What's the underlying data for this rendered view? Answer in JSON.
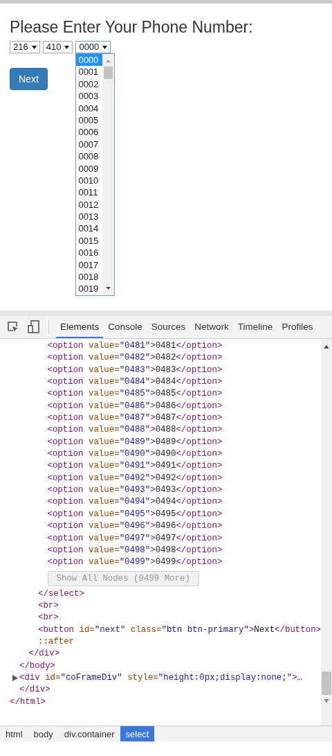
{
  "page": {
    "title": "Please Enter Your Phone Number:",
    "selects": [
      {
        "value": "216",
        "open": false
      },
      {
        "value": "410",
        "open": false
      },
      {
        "value": "0000",
        "open": true
      }
    ],
    "dropdown_options": [
      {
        "label": "0000",
        "selected": true
      },
      {
        "label": "0001",
        "selected": false
      },
      {
        "label": "0002",
        "selected": false
      },
      {
        "label": "0003",
        "selected": false
      },
      {
        "label": "0004",
        "selected": false
      },
      {
        "label": "0005",
        "selected": false
      },
      {
        "label": "0006",
        "selected": false
      },
      {
        "label": "0007",
        "selected": false
      },
      {
        "label": "0008",
        "selected": false
      },
      {
        "label": "0009",
        "selected": false
      },
      {
        "label": "0010",
        "selected": false
      },
      {
        "label": "0011",
        "selected": false
      },
      {
        "label": "0012",
        "selected": false
      },
      {
        "label": "0013",
        "selected": false
      },
      {
        "label": "0014",
        "selected": false
      },
      {
        "label": "0015",
        "selected": false
      },
      {
        "label": "0016",
        "selected": false
      },
      {
        "label": "0017",
        "selected": false
      },
      {
        "label": "0018",
        "selected": false
      },
      {
        "label": "0019",
        "selected": false
      }
    ],
    "next_button": "Next"
  },
  "devtools": {
    "tabs": [
      {
        "label": "Elements",
        "selected": true
      },
      {
        "label": "Console",
        "selected": false
      },
      {
        "label": "Sources",
        "selected": false
      },
      {
        "label": "Network",
        "selected": false
      },
      {
        "label": "Timeline",
        "selected": false
      },
      {
        "label": "Profiles",
        "selected": false
      }
    ],
    "dom_tree": [
      {
        "closing": [
          {
            "kind": "tag",
            "text": "</html>"
          }
        ],
        "children": [
          {
            "closing": [
              {
                "kind": "tag",
                "text": "</body>"
              }
            ],
            "children": [
              {
                "closing": [
                  {
                    "kind": "tag",
                    "text": "</div>"
                  }
                ],
                "children": [
                  {
                    "closing": [
                      {
                        "kind": "tag",
                        "text": "</select>"
                      }
                    ],
                    "children": [
                      {
                        "tokens": [
                          {
                            "kind": "tag",
                            "text": "<option"
                          },
                          {
                            "kind": "attr",
                            "text": " value="
                          },
                          {
                            "kind": "value",
                            "text": "\"0481\""
                          },
                          {
                            "kind": "tag",
                            "text": ">"
                          },
                          {
                            "kind": "text",
                            "text": "0481"
                          },
                          {
                            "kind": "tag",
                            "text": "</option>"
                          }
                        ]
                      },
                      {
                        "tokens": [
                          {
                            "kind": "tag",
                            "text": "<option"
                          },
                          {
                            "kind": "attr",
                            "text": " value="
                          },
                          {
                            "kind": "value",
                            "text": "\"0482\""
                          },
                          {
                            "kind": "tag",
                            "text": ">"
                          },
                          {
                            "kind": "text",
                            "text": "0482"
                          },
                          {
                            "kind": "tag",
                            "text": "</option>"
                          }
                        ]
                      },
                      {
                        "tokens": [
                          {
                            "kind": "tag",
                            "text": "<option"
                          },
                          {
                            "kind": "attr",
                            "text": " value="
                          },
                          {
                            "kind": "value",
                            "text": "\"0483\""
                          },
                          {
                            "kind": "tag",
                            "text": ">"
                          },
                          {
                            "kind": "text",
                            "text": "0483"
                          },
                          {
                            "kind": "tag",
                            "text": "</option>"
                          }
                        ]
                      },
                      {
                        "tokens": [
                          {
                            "kind": "tag",
                            "text": "<option"
                          },
                          {
                            "kind": "attr",
                            "text": " value="
                          },
                          {
                            "kind": "value",
                            "text": "\"0484\""
                          },
                          {
                            "kind": "tag",
                            "text": ">"
                          },
                          {
                            "kind": "text",
                            "text": "0484"
                          },
                          {
                            "kind": "tag",
                            "text": "</option>"
                          }
                        ]
                      },
                      {
                        "tokens": [
                          {
                            "kind": "tag",
                            "text": "<option"
                          },
                          {
                            "kind": "attr",
                            "text": " value="
                          },
                          {
                            "kind": "value",
                            "text": "\"0485\""
                          },
                          {
                            "kind": "tag",
                            "text": ">"
                          },
                          {
                            "kind": "text",
                            "text": "0485"
                          },
                          {
                            "kind": "tag",
                            "text": "</option>"
                          }
                        ]
                      },
                      {
                        "tokens": [
                          {
                            "kind": "tag",
                            "text": "<option"
                          },
                          {
                            "kind": "attr",
                            "text": " value="
                          },
                          {
                            "kind": "value",
                            "text": "\"0486\""
                          },
                          {
                            "kind": "tag",
                            "text": ">"
                          },
                          {
                            "kind": "text",
                            "text": "0486"
                          },
                          {
                            "kind": "tag",
                            "text": "</option>"
                          }
                        ]
                      },
                      {
                        "tokens": [
                          {
                            "kind": "tag",
                            "text": "<option"
                          },
                          {
                            "kind": "attr",
                            "text": " value="
                          },
                          {
                            "kind": "value",
                            "text": "\"0487\""
                          },
                          {
                            "kind": "tag",
                            "text": ">"
                          },
                          {
                            "kind": "text",
                            "text": "0487"
                          },
                          {
                            "kind": "tag",
                            "text": "</option>"
                          }
                        ]
                      },
                      {
                        "tokens": [
                          {
                            "kind": "tag",
                            "text": "<option"
                          },
                          {
                            "kind": "attr",
                            "text": " value="
                          },
                          {
                            "kind": "value",
                            "text": "\"0488\""
                          },
                          {
                            "kind": "tag",
                            "text": ">"
                          },
                          {
                            "kind": "text",
                            "text": "0488"
                          },
                          {
                            "kind": "tag",
                            "text": "</option>"
                          }
                        ]
                      },
                      {
                        "tokens": [
                          {
                            "kind": "tag",
                            "text": "<option"
                          },
                          {
                            "kind": "attr",
                            "text": " value="
                          },
                          {
                            "kind": "value",
                            "text": "\"0489\""
                          },
                          {
                            "kind": "tag",
                            "text": ">"
                          },
                          {
                            "kind": "text",
                            "text": "0489"
                          },
                          {
                            "kind": "tag",
                            "text": "</option>"
                          }
                        ]
                      },
                      {
                        "tokens": [
                          {
                            "kind": "tag",
                            "text": "<option"
                          },
                          {
                            "kind": "attr",
                            "text": " value="
                          },
                          {
                            "kind": "value",
                            "text": "\"0490\""
                          },
                          {
                            "kind": "tag",
                            "text": ">"
                          },
                          {
                            "kind": "text",
                            "text": "0490"
                          },
                          {
                            "kind": "tag",
                            "text": "</option>"
                          }
                        ]
                      },
                      {
                        "tokens": [
                          {
                            "kind": "tag",
                            "text": "<option"
                          },
                          {
                            "kind": "attr",
                            "text": " value="
                          },
                          {
                            "kind": "value",
                            "text": "\"0491\""
                          },
                          {
                            "kind": "tag",
                            "text": ">"
                          },
                          {
                            "kind": "text",
                            "text": "0491"
                          },
                          {
                            "kind": "tag",
                            "text": "</option>"
                          }
                        ]
                      },
                      {
                        "tokens": [
                          {
                            "kind": "tag",
                            "text": "<option"
                          },
                          {
                            "kind": "attr",
                            "text": " value="
                          },
                          {
                            "kind": "value",
                            "text": "\"0492\""
                          },
                          {
                            "kind": "tag",
                            "text": ">"
                          },
                          {
                            "kind": "text",
                            "text": "0492"
                          },
                          {
                            "kind": "tag",
                            "text": "</option>"
                          }
                        ]
                      },
                      {
                        "tokens": [
                          {
                            "kind": "tag",
                            "text": "<option"
                          },
                          {
                            "kind": "attr",
                            "text": " value="
                          },
                          {
                            "kind": "value",
                            "text": "\"0493\""
                          },
                          {
                            "kind": "tag",
                            "text": ">"
                          },
                          {
                            "kind": "text",
                            "text": "0493"
                          },
                          {
                            "kind": "tag",
                            "text": "</option>"
                          }
                        ]
                      },
                      {
                        "tokens": [
                          {
                            "kind": "tag",
                            "text": "<option"
                          },
                          {
                            "kind": "attr",
                            "text": " value="
                          },
                          {
                            "kind": "value",
                            "text": "\"0494\""
                          },
                          {
                            "kind": "tag",
                            "text": ">"
                          },
                          {
                            "kind": "text",
                            "text": "0494"
                          },
                          {
                            "kind": "tag",
                            "text": "</option>"
                          }
                        ]
                      },
                      {
                        "tokens": [
                          {
                            "kind": "tag",
                            "text": "<option"
                          },
                          {
                            "kind": "attr",
                            "text": " value="
                          },
                          {
                            "kind": "value",
                            "text": "\"0495\""
                          },
                          {
                            "kind": "tag",
                            "text": ">"
                          },
                          {
                            "kind": "text",
                            "text": "0495"
                          },
                          {
                            "kind": "tag",
                            "text": "</option>"
                          }
                        ]
                      },
                      {
                        "tokens": [
                          {
                            "kind": "tag",
                            "text": "<option"
                          },
                          {
                            "kind": "attr",
                            "text": " value="
                          },
                          {
                            "kind": "value",
                            "text": "\"0496\""
                          },
                          {
                            "kind": "tag",
                            "text": ">"
                          },
                          {
                            "kind": "text",
                            "text": "0496"
                          },
                          {
                            "kind": "tag",
                            "text": "</option>"
                          }
                        ]
                      },
                      {
                        "tokens": [
                          {
                            "kind": "tag",
                            "text": "<option"
                          },
                          {
                            "kind": "attr",
                            "text": " value="
                          },
                          {
                            "kind": "value",
                            "text": "\"0497\""
                          },
                          {
                            "kind": "tag",
                            "text": ">"
                          },
                          {
                            "kind": "text",
                            "text": "0497"
                          },
                          {
                            "kind": "tag",
                            "text": "</option>"
                          }
                        ]
                      },
                      {
                        "tokens": [
                          {
                            "kind": "tag",
                            "text": "<option"
                          },
                          {
                            "kind": "attr",
                            "text": " value="
                          },
                          {
                            "kind": "value",
                            "text": "\"0498\""
                          },
                          {
                            "kind": "tag",
                            "text": ">"
                          },
                          {
                            "kind": "text",
                            "text": "0498"
                          },
                          {
                            "kind": "tag",
                            "text": "</option>"
                          }
                        ]
                      },
                      {
                        "tokens": [
                          {
                            "kind": "tag",
                            "text": "<option"
                          },
                          {
                            "kind": "attr",
                            "text": " value="
                          },
                          {
                            "kind": "value",
                            "text": "\"0499\""
                          },
                          {
                            "kind": "tag",
                            "text": ">"
                          },
                          {
                            "kind": "text",
                            "text": "0499"
                          },
                          {
                            "kind": "tag",
                            "text": "</option>"
                          }
                        ]
                      },
                      {
                        "kind": "more_button",
                        "label": "Show All Nodes (9499 More)"
                      }
                    ]
                  },
                  {
                    "tokens": [
                      {
                        "kind": "tag",
                        "text": "<br>"
                      }
                    ]
                  },
                  {
                    "tokens": [
                      {
                        "kind": "tag",
                        "text": "<br>"
                      }
                    ]
                  },
                  {
                    "tokens": [
                      {
                        "kind": "tag",
                        "text": "<button"
                      },
                      {
                        "kind": "attr",
                        "text": " id="
                      },
                      {
                        "kind": "value",
                        "text": "\"next\""
                      },
                      {
                        "kind": "attr",
                        "text": " class="
                      },
                      {
                        "kind": "value",
                        "text": "\"btn btn-primary\""
                      },
                      {
                        "kind": "tag",
                        "text": ">"
                      },
                      {
                        "kind": "text",
                        "text": "Next"
                      },
                      {
                        "kind": "tag",
                        "text": "</button>"
                      }
                    ]
                  },
                  {
                    "tokens": [
                      {
                        "kind": "pseudo",
                        "text": "::after"
                      }
                    ]
                  }
                ]
              }
            ]
          },
          {
            "expanded": false,
            "tokens": [
              {
                "kind": "tag",
                "text": "<div"
              },
              {
                "kind": "attr",
                "text": " id="
              },
              {
                "kind": "value",
                "text": "\"coFrameDiv\""
              },
              {
                "kind": "attr",
                "text": " style="
              },
              {
                "kind": "value",
                "text": "\"height:0px;display:none;\""
              },
              {
                "kind": "tag",
                "text": ">"
              },
              {
                "kind": "text",
                "text": "…"
              },
              {
                "kind": "tag",
                "text": "</div>"
              }
            ]
          }
        ]
      }
    ],
    "breadcrumbs": [
      {
        "label": "html",
        "selected": false
      },
      {
        "label": "body",
        "selected": false
      },
      {
        "label": "div.container",
        "selected": false
      },
      {
        "label": "select",
        "selected": true
      }
    ]
  }
}
